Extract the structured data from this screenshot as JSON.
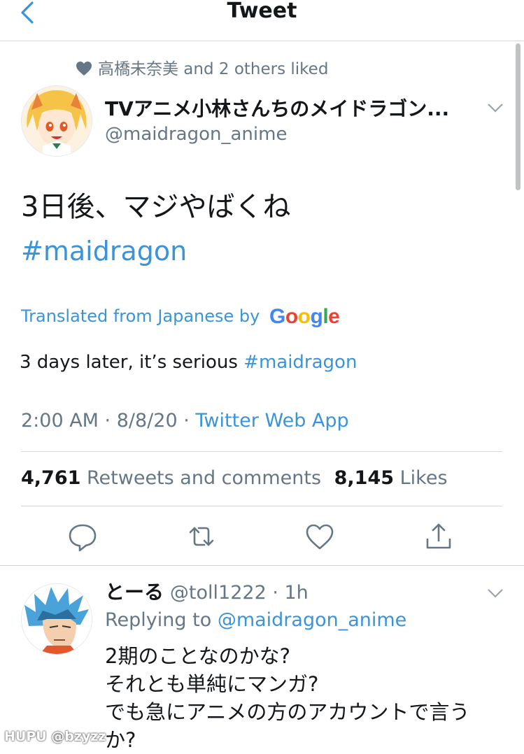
{
  "nav": {
    "title": "Tweet",
    "back_icon": "chevron-left-icon"
  },
  "social_context": {
    "icon": "heart-icon",
    "text": "高橋未奈美 and 2 others liked"
  },
  "author": {
    "display_name": "TVアニメ小林さんちのメイドラゴン...",
    "handle": "@maidragon_anime"
  },
  "tweet": {
    "text": "3日後、マジやばくね",
    "hashtag": "#maidragon",
    "translated_label": "Translated from Japanese by",
    "translator": "Google",
    "translation_text": "3 days later, it’s serious ",
    "translation_hashtag": "#maidragon",
    "time": "2:00 AM · 8/8/20 · ",
    "source": "Twitter Web App"
  },
  "stats": {
    "retweets_count": "4,761",
    "retweets_label": "Retweets and comments",
    "likes_count": "8,145",
    "likes_label": "Likes"
  },
  "actions": [
    "reply-icon",
    "retweet-icon",
    "like-icon",
    "share-icon"
  ],
  "reply": {
    "name": "とーる",
    "handle": "@toll1222 · 1h",
    "replying_label": "Replying to ",
    "replying_to": "@maidragon_anime",
    "lines": [
      "2期のことなのかな?",
      "それとも単純にマンガ?",
      "でも急にアニメの方のアカウントで言う",
      "か?"
    ]
  },
  "watermark": "HUPU @bzyzz",
  "colors": {
    "link": "#3b94d9",
    "secondary_text": "#657786",
    "divider": "#d6d9db"
  }
}
